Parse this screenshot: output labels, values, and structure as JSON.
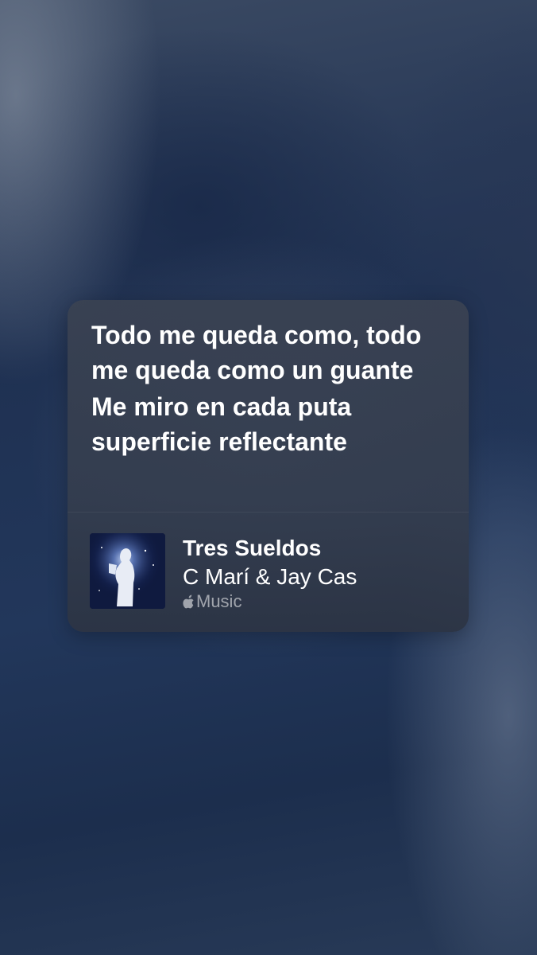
{
  "lyrics_card": {
    "lines": [
      "Todo me queda como, todo me queda como un guante",
      "Me miro en cada puta superficie reflectante"
    ]
  },
  "song": {
    "title": "Tres Sueldos",
    "artist": "C Marí & Jay Cas",
    "source_icon": "apple-logo-icon",
    "source_label": "Music"
  },
  "colors": {
    "text_primary": "#ffffff",
    "text_secondary": "#8f96a3",
    "card_background": "#3a4252",
    "background": "#22375b"
  }
}
